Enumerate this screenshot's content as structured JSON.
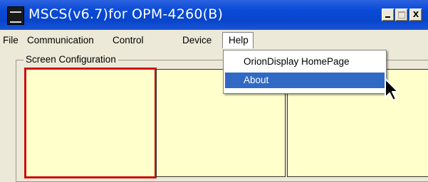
{
  "window": {
    "title": "MSCS(v6.7)for OPM-4260(B)",
    "icon": "app-logo-icon",
    "controls": {
      "minimize": "minimize-icon",
      "maximize": "maximize-icon",
      "close_label": "x"
    }
  },
  "menubar": {
    "file": "File",
    "communication": "Communication",
    "control": "Control",
    "device": "Device",
    "help": "Help"
  },
  "help_menu": {
    "items": [
      "OrionDisplay HomePage",
      "About"
    ],
    "highlighted": "About",
    "highlight_color": "#316ac5"
  },
  "screen_config": {
    "label": "Screen Configuration",
    "pane_color": "#ffffcc",
    "selected_pane_border": "#cc1111"
  },
  "pointer": "mouse-pointer-icon"
}
